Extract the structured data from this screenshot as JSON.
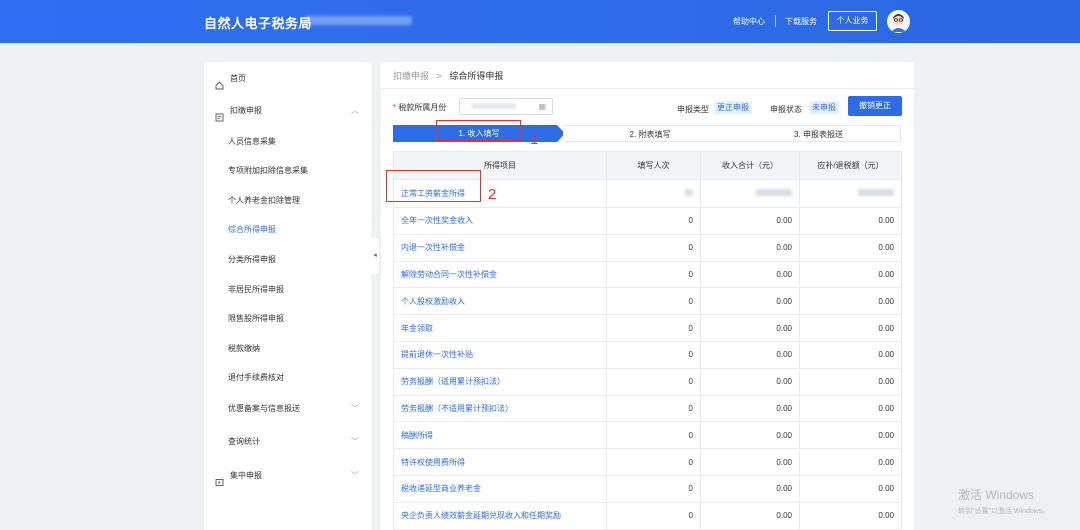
{
  "header": {
    "title": "自然人电子税务局",
    "help_label": "帮助中心",
    "download_label": "下载服务",
    "personal_label": "个人业务"
  },
  "sidebar": {
    "items": [
      {
        "label": "首页",
        "icon": "home-icon"
      },
      {
        "label": "扣缴申报",
        "icon": "declare-icon",
        "expanded": true
      }
    ],
    "sub_items": [
      {
        "label": "人员信息采集"
      },
      {
        "label": "专项附加扣除信息采集"
      },
      {
        "label": "个人养老金扣除管理"
      },
      {
        "label": "综合所得申报",
        "active": true
      },
      {
        "label": "分类所得申报"
      },
      {
        "label": "非居民所得申报"
      },
      {
        "label": "限售股所得申报"
      },
      {
        "label": "税款缴纳"
      },
      {
        "label": "退付手续费核对"
      },
      {
        "label": "优惠备案与信息报送"
      },
      {
        "label": "查询统计"
      }
    ],
    "bottom_item": {
      "label": "集中申报",
      "icon": "batch-icon"
    }
  },
  "breadcrumb": {
    "parent": "扣缴申报",
    "separator": ">",
    "current": "综合所得申报"
  },
  "form": {
    "month_label": "税款所属月份",
    "required_mark": "*",
    "type_label": "申报类型",
    "type_value": "更正申报",
    "status_label": "申报状态",
    "status_value": "未申报",
    "revoke_label": "撤销更正"
  },
  "steps": [
    {
      "label": "1. 收入填写",
      "active": true
    },
    {
      "label": "2. 附表填写",
      "active": false
    },
    {
      "label": "3. 申报表报送",
      "active": false
    }
  ],
  "annotations": {
    "mark1": "1",
    "mark2": "2"
  },
  "table": {
    "columns": [
      "所得项目",
      "填写人次",
      "收入合计（元）",
      "应补/退税额（元）"
    ],
    "rows": [
      {
        "item": "正常工资薪金所得",
        "count": "",
        "income": "",
        "tax": ""
      },
      {
        "item": "全年一次性奖金收入",
        "count": "0",
        "income": "0.00",
        "tax": "0.00"
      },
      {
        "item": "内退一次性补偿金",
        "count": "0",
        "income": "0.00",
        "tax": "0.00"
      },
      {
        "item": "解除劳动合同一次性补偿金",
        "count": "0",
        "income": "0.00",
        "tax": "0.00"
      },
      {
        "item": "个人股权激励收入",
        "count": "0",
        "income": "0.00",
        "tax": "0.00"
      },
      {
        "item": "年金领取",
        "count": "0",
        "income": "0.00",
        "tax": "0.00"
      },
      {
        "item": "提前退休一次性补贴",
        "count": "0",
        "income": "0.00",
        "tax": "0.00"
      },
      {
        "item": "劳务报酬（适用累计预扣法）",
        "count": "0",
        "income": "0.00",
        "tax": "0.00"
      },
      {
        "item": "劳务报酬（不适用累计预扣法）",
        "count": "0",
        "income": "0.00",
        "tax": "0.00"
      },
      {
        "item": "稿酬所得",
        "count": "0",
        "income": "0.00",
        "tax": "0.00"
      },
      {
        "item": "特许权使用费所得",
        "count": "0",
        "income": "0.00",
        "tax": "0.00"
      },
      {
        "item": "税收递延型商业养老金",
        "count": "0",
        "income": "0.00",
        "tax": "0.00"
      },
      {
        "item": "央企负责人绩效薪金延期兑现收入和任期奖励",
        "count": "0",
        "income": "0.00",
        "tax": "0.00"
      }
    ]
  },
  "watermark": {
    "line1": "激活 Windows",
    "line2": "转到\"设置\"以激活 Windows。"
  }
}
